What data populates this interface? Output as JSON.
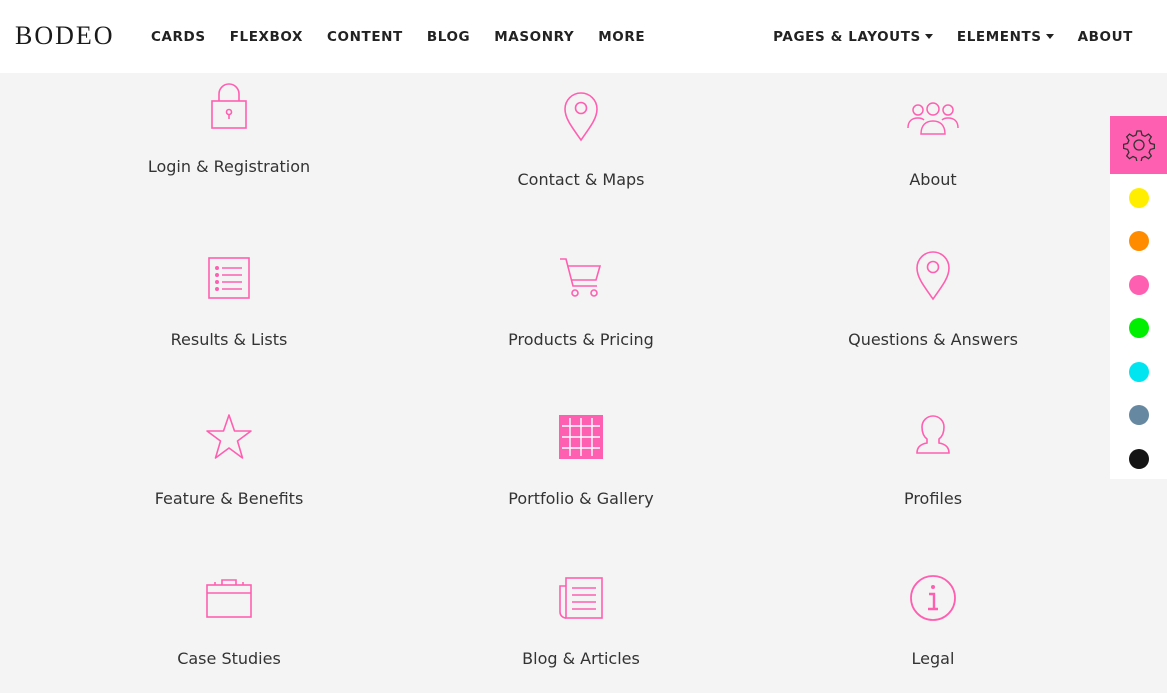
{
  "brand": "BODEO",
  "nav": {
    "left": [
      "CARDS",
      "FLEXBOX",
      "CONTENT",
      "BLOG",
      "MASONRY",
      "MORE"
    ],
    "right": [
      {
        "label": "PAGES & LAYOUTS",
        "dropdown": true
      },
      {
        "label": "ELEMENTS",
        "dropdown": true
      },
      {
        "label": "ABOUT",
        "dropdown": false
      }
    ]
  },
  "accent_color": "#ff5fb0",
  "tiles": [
    {
      "label": "Login & Registration",
      "icon": "lock-icon"
    },
    {
      "label": "Contact & Maps",
      "icon": "map-pin-icon"
    },
    {
      "label": "About",
      "icon": "users-icon"
    },
    {
      "label": "Results & Lists",
      "icon": "list-icon"
    },
    {
      "label": "Products & Pricing",
      "icon": "cart-icon"
    },
    {
      "label": "Questions & Answers",
      "icon": "map-pin-icon"
    },
    {
      "label": "Feature & Benefits",
      "icon": "star-icon"
    },
    {
      "label": "Portfolio & Gallery",
      "icon": "grid-icon"
    },
    {
      "label": "Profiles",
      "icon": "user-icon"
    },
    {
      "label": "Case Studies",
      "icon": "briefcase-icon"
    },
    {
      "label": "Blog & Articles",
      "icon": "newspaper-icon"
    },
    {
      "label": "Legal",
      "icon": "info-icon"
    }
  ],
  "color_switcher": {
    "icon": "gear-icon",
    "colors": [
      "#ffee00",
      "#ff8c00",
      "#ff5fb0",
      "#00ee00",
      "#00e5f0",
      "#6688a0",
      "#151515"
    ]
  }
}
